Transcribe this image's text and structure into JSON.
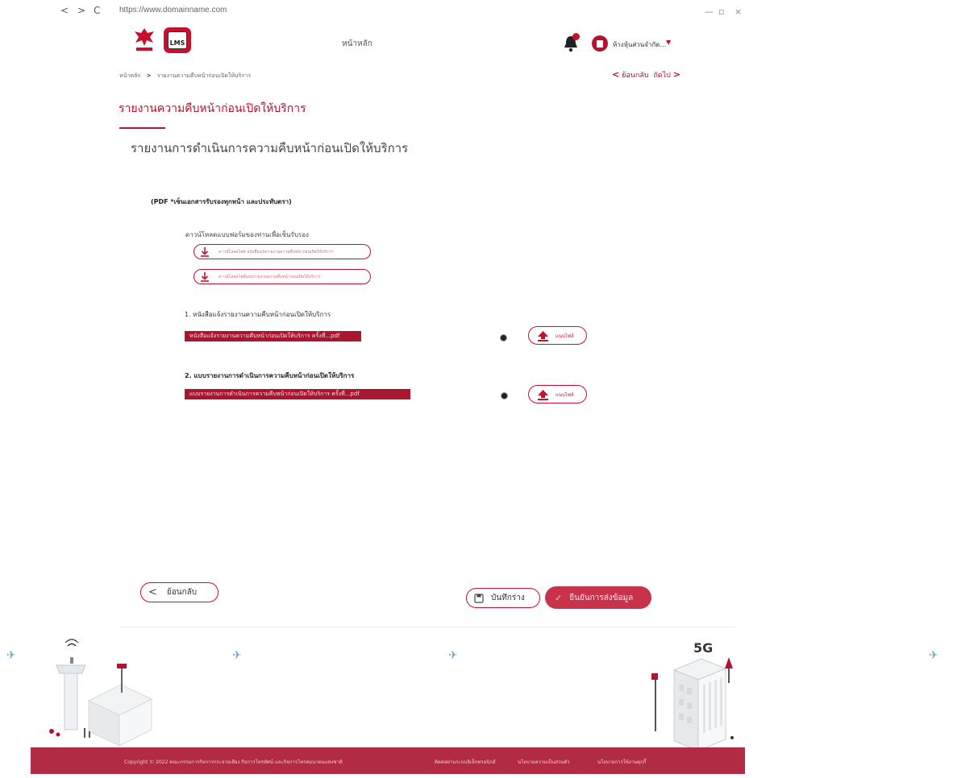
{
  "browser": {
    "back": "<",
    "forward": ">",
    "reload": "C",
    "url": "https://www.domainname.com",
    "minimize": "—",
    "restore": "▫",
    "close": "×"
  },
  "header": {
    "logo_text": "LMS",
    "home": "หน้าหลัก",
    "user_name": "ห้างหุ้นส่วนจำกัด...",
    "notification_count": "1",
    "accent_color": "#c8102e"
  },
  "breadcrumb": {
    "home": "หน้าหลัก",
    "separator": ">",
    "current": "รายงานความคืบหน้าก่อนเปิดให้บริการ"
  },
  "pager": {
    "prev": "ย้อนกลับ",
    "next": "ถัดไป"
  },
  "page_title": "รายงานความคืบหน้าก่อนเปิดให้บริการ",
  "section_title": "รายงานการดำเนินการความคืบหน้าก่อนเปิดให้บริการ",
  "pdf_note": "(PDF *เซ็นเอกสารรับรองทุกหน้า และประทับตรา)",
  "downloads": {
    "heading": "ดาวน์โหลดแบบฟอร์มของท่านเพื่อเซ็นรับรอง",
    "items": [
      "ดาวน์โหลดไฟล์ หนังสือแจ้งรายงานความคืบหน้าก่อนเปิดให้บริการ",
      "ดาวน์โหลดไฟล์แบบรายงานความคืบหน้าก่อนเปิดให้บริการ"
    ]
  },
  "uploads": [
    {
      "label": "1. หนังสือแจ้งรายงานความคืบหน้าก่อนเปิดให้บริการ",
      "file": "หนังสือแจ้งรายงานความคืบหน้าก่อนเปิดให้บริการ ครั้งที่...pdf",
      "button": "แนบไฟล์"
    },
    {
      "label": "2. แบบรายงานการดำเนินการความคืบหน้าก่อนเปิดให้บริการ",
      "file": "แบบรายงานการดำเนินการความคืบหน้าก่อนเปิดให้บริการ ครั้งที่...pdf",
      "button": "แนบไฟล์"
    }
  ],
  "actions": {
    "back": "ย้อนกลับ",
    "save_draft": "บันทึกร่าง",
    "confirm": "ยืนยันการส่งข้อมูล"
  },
  "illustration": {
    "badge": "5G"
  },
  "footer": {
    "copyright": "Copyright © 2022 คณะกรรมการกิจการกระจายเสียง กิจการโทรทัศน์ และกิจการโทรคมนาคมแห่งชาติ",
    "links": [
      "ติดต่อผ่านระบบอิเล็กทรอนิกส์",
      "นโยบายความเป็นส่วนตัว",
      "นโยบายการใช้งานคุกกี้"
    ]
  }
}
